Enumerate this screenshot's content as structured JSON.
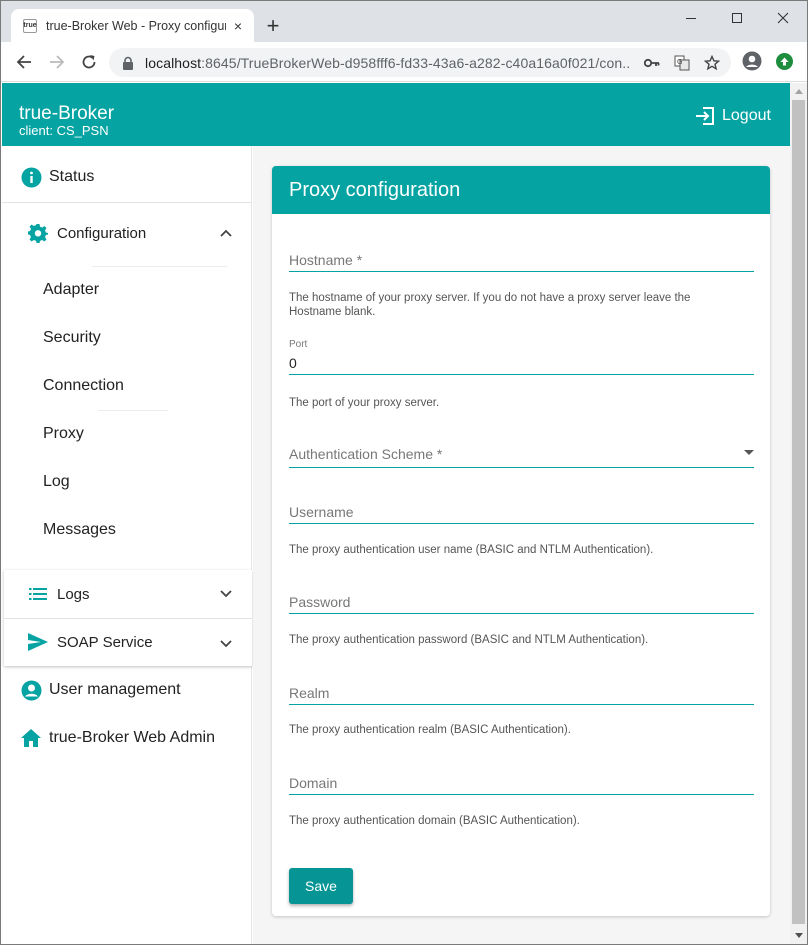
{
  "browser": {
    "tab_title": "true-Broker Web - Proxy configur",
    "favicon_text": "true",
    "tab_close": "×",
    "new_tab": "+",
    "url_host": "localhost",
    "url_rest": ":8645/TrueBrokerWeb-d958fff6-fd33-43a6-a282-c40a16a0f021/con..."
  },
  "header": {
    "title": "true-Broker",
    "client": "client: CS_PSN",
    "logout_label": "Logout"
  },
  "sidebar": {
    "status": "Status",
    "configuration": {
      "label": "Configuration",
      "items": [
        "Adapter",
        "Security",
        "Connection",
        "Proxy",
        "Log",
        "Messages"
      ]
    },
    "logs": "Logs",
    "soap_service": "SOAP Service",
    "user_management": "User management",
    "web_admin": "true-Broker Web Admin"
  },
  "form": {
    "title": "Proxy configuration",
    "hostname": {
      "label": "Hostname *",
      "value": "",
      "hint": "The hostname of your proxy server. If you do not have a proxy server leave the Hostname blank."
    },
    "port": {
      "label": "Port",
      "value": "0",
      "hint": "The port of your proxy server."
    },
    "auth_scheme": {
      "label": "Authentication Scheme *",
      "value": ""
    },
    "username": {
      "label": "Username",
      "value": "",
      "hint": "The proxy authentication user name (BASIC and NTLM Authentication)."
    },
    "password": {
      "label": "Password",
      "value": "",
      "hint": "The proxy authentication password (BASIC and NTLM Authentication)."
    },
    "realm": {
      "label": "Realm",
      "value": "",
      "hint": "The proxy authentication realm (BASIC Authentication)."
    },
    "domain": {
      "label": "Domain",
      "value": "",
      "hint": "The proxy authentication domain (BASIC Authentication)."
    },
    "save_label": "Save"
  },
  "colors": {
    "accent": "#06a3a3",
    "button": "#069494"
  }
}
